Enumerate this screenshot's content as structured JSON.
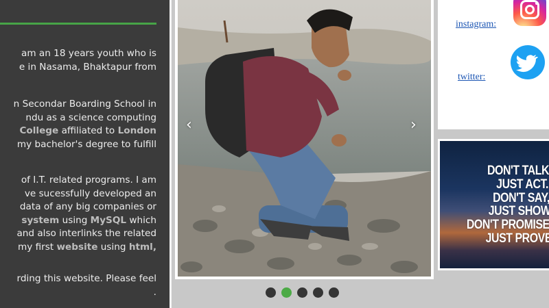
{
  "bio": {
    "p1": [
      "am an 18 years youth who is",
      "e in Nasama, Bhaktapur from"
    ],
    "p2": {
      "l1": "n Secondar Boarding School in",
      "l2": "ndu as a science computing",
      "l3_bold1": "College",
      "l3_mid": " affiliated to ",
      "l3_bold2": "London",
      "l4": "my bachelor's degree to fulfill"
    },
    "p3": {
      "l1": "of I.T. related programs. I am",
      "l2": "ve sucessfully developed an",
      "l3": "data of any big companies or",
      "l4_bold1": "system",
      "l4_mid": " using ",
      "l4_bold2": "MySQL",
      "l4_end": " which",
      "l5": "and also interlinks the related",
      "l6_pre": "my first ",
      "l6_bold1": "website",
      "l6_mid": " using ",
      "l6_bold2": "html,"
    },
    "p4": [
      "rding this website. Please feel",
      "."
    ]
  },
  "slider": {
    "prev_symbol": "‹",
    "next_symbol": "›",
    "dots": 5,
    "active_dot": 1,
    "image_subject": "young man crouching by a riverbank"
  },
  "social": {
    "instagram_label": "instagram:",
    "twitter_label": "twitter:",
    "instagram_icon": "instagram-icon",
    "twitter_icon": "twitter-icon"
  },
  "quote": {
    "lines": [
      "DON'T TALK,",
      "JUST ACT.",
      "DON'T SAY,",
      "JUST SHOW.",
      "DON'T PROMISE,",
      "JUST PROVE."
    ]
  },
  "colors": {
    "accent_green": "#47a447",
    "bio_background": "#3b3b3b",
    "link_blue": "#1b55b3",
    "twitter_blue": "#1da1f2"
  }
}
